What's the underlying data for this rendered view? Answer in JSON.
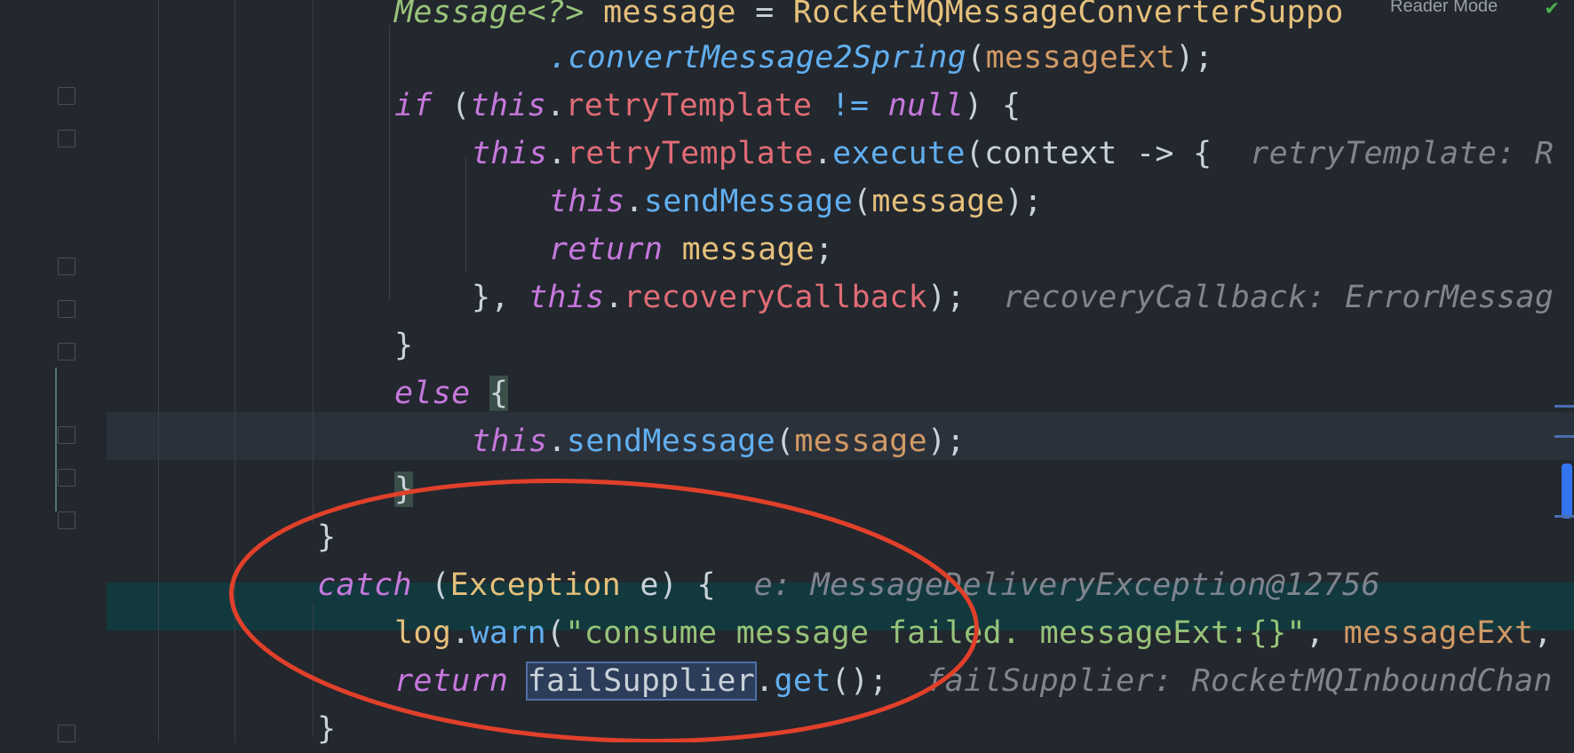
{
  "toolbar": {
    "reader_mode_label": "Reader Mode"
  },
  "code": {
    "l1_type": "Message<?>",
    "l1_var": "message",
    "l1_eq": "=",
    "l1_call": "RocketMQMessageConverterSuppo",
    "l2_method": ".convertMessage2Spring",
    "l2_arg": "messageExt",
    "l3_kw": "if",
    "l3_this": "this",
    "l3_field": "retryTemplate",
    "l3_op": "!=",
    "l3_null": "null",
    "l4_this": "this",
    "l4_field": "retryTemplate",
    "l4_method": "execute",
    "l4_param": "context",
    "l4_hint": "retryTemplate: R",
    "l5_this": "this",
    "l5_method": "sendMessage",
    "l5_arg": "message",
    "l6_kw": "return",
    "l6_var": "message",
    "l7_this": "this",
    "l7_field": "recoveryCallback",
    "l7_hint": "recoveryCallback: ErrorMessag",
    "l9_kw": "else",
    "l10_this": "this",
    "l10_method": "sendMessage",
    "l10_arg": "message",
    "l13_kw": "catch",
    "l13_type": "Exception",
    "l13_var": "e",
    "l13_hint": "e: MessageDeliveryException@12756",
    "l14_obj": "log",
    "l14_method": "warn",
    "l14_str": "\"consume message failed. messageExt:{}\"",
    "l14_arg": "messageExt",
    "l15_kw": "return",
    "l15_var": "failSupplier",
    "l15_method": "get",
    "l15_hint": "failSupplier: RocketMQInboundChan"
  },
  "annotation": {
    "shape": "ellipse",
    "color": "#e0402a"
  },
  "colors": {
    "background": "#23272e",
    "current_line": "#2b313a",
    "execution_line": "#12393e",
    "accent": "#3574f0"
  }
}
